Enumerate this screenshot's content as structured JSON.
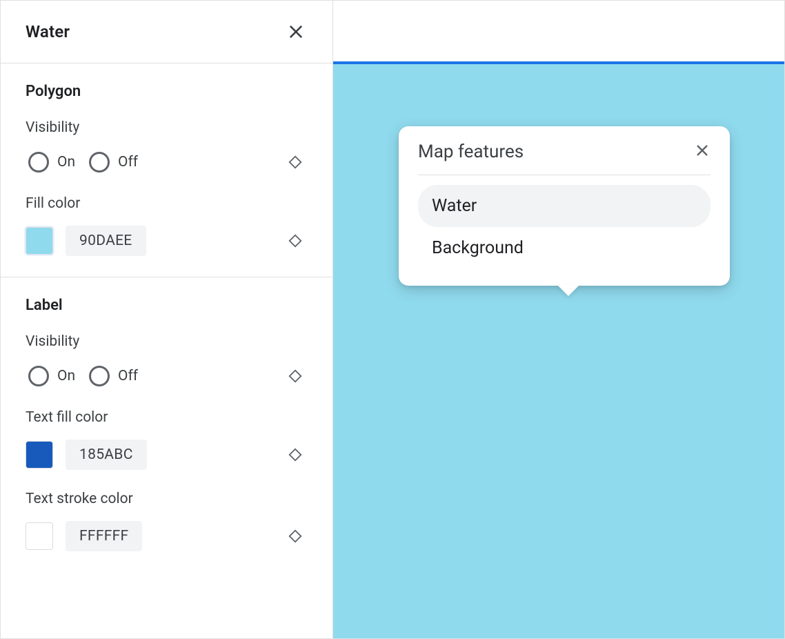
{
  "panel": {
    "title": "Water",
    "sections": {
      "polygon": {
        "heading": "Polygon",
        "visibility": {
          "label": "Visibility",
          "on": "On",
          "off": "Off"
        },
        "fill": {
          "label": "Fill color",
          "hex": "90DAEE",
          "color": "#90DAEE"
        }
      },
      "label": {
        "heading": "Label",
        "visibility": {
          "label": "Visibility",
          "on": "On",
          "off": "Off"
        },
        "textFill": {
          "label": "Text fill color",
          "hex": "185ABC",
          "color": "#185ABC"
        },
        "textStroke": {
          "label": "Text stroke color",
          "hex": "FFFFFF",
          "color": "#FFFFFF"
        }
      }
    }
  },
  "preview": {
    "waterColor": "#90DAEE",
    "accentColor": "#1a73e8",
    "popup": {
      "title": "Map features",
      "items": [
        {
          "label": "Water",
          "selected": true
        },
        {
          "label": "Background",
          "selected": false
        }
      ]
    }
  }
}
